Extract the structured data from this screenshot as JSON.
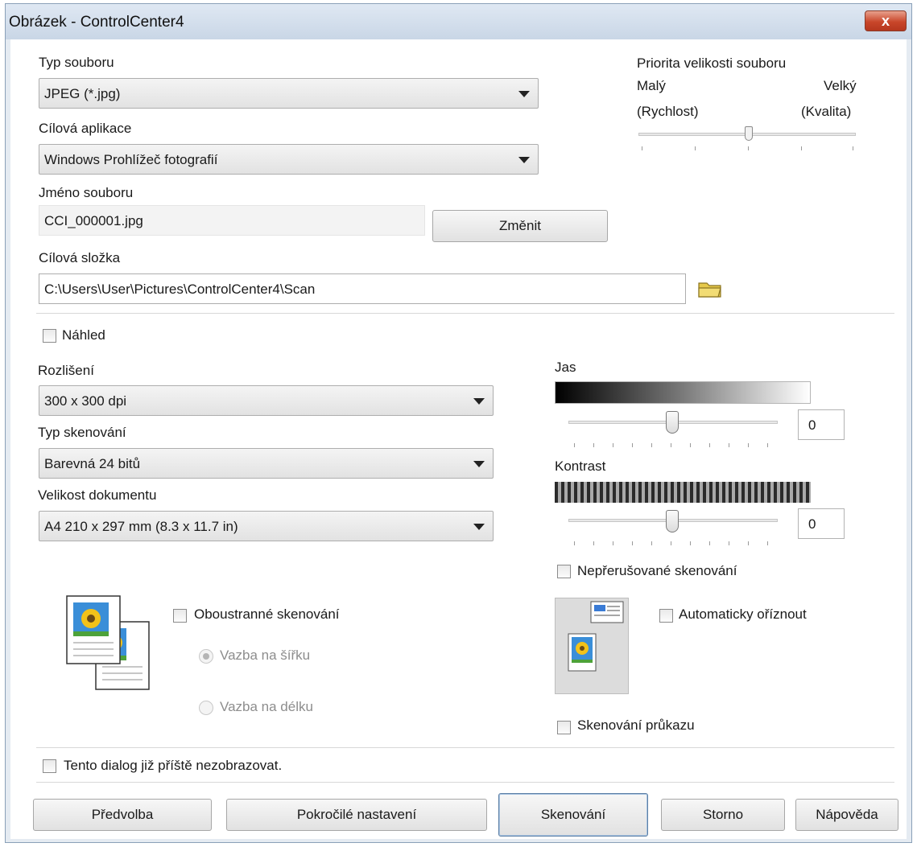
{
  "window": {
    "title": "Obrázek - ControlCenter4",
    "close_label": "x"
  },
  "file": {
    "type_label": "Typ souboru",
    "type_value": "JPEG (*.jpg)",
    "app_label": "Cílová aplikace",
    "app_value": "Windows Prohlížeč fotografií",
    "name_label": "Jméno souboru",
    "name_value": "CCI_000001.jpg",
    "change_button": "Změnit",
    "folder_label": "Cílová složka",
    "folder_value": "C:\\Users\\User\\Pictures\\ControlCenter4\\Scan",
    "folder_icon": "folder-icon"
  },
  "priority": {
    "label": "Priorita velikosti souboru",
    "small": "Malý",
    "large": "Velký",
    "speed": "(Rychlost)",
    "quality": "(Kvalita)",
    "level": 0.5
  },
  "preview": {
    "label": "Náhled",
    "checked": false
  },
  "scan": {
    "resolution_label": "Rozlišení",
    "resolution_value": "300 x 300 dpi",
    "type_label": "Typ skenování",
    "type_value": "Barevná 24 bitů",
    "size_label": "Velikost dokumentu",
    "size_value": "A4 210 x 297 mm (8.3 x 11.7 in)"
  },
  "brightness": {
    "label": "Jas",
    "value": "0"
  },
  "contrast": {
    "label": "Kontrast",
    "value": "0"
  },
  "options": {
    "continuous": "Nepřerušované skenování",
    "duplex": "Oboustranné skenování",
    "long_edge": "Vazba na šířku",
    "short_edge": "Vazba na délku",
    "autocrop": "Automaticky oříznout",
    "idcard": "Skenování průkazu",
    "dont_show": "Tento dialog již příště nezobrazovat."
  },
  "buttons": {
    "preset": "Předvolba",
    "advanced": "Pokročilé nastavení",
    "scan": "Skenování",
    "cancel": "Storno",
    "help": "Nápověda"
  },
  "colors": {
    "titlebar": "#c9d6e6",
    "close": "#c9462a",
    "folder": "#e6c94a"
  }
}
